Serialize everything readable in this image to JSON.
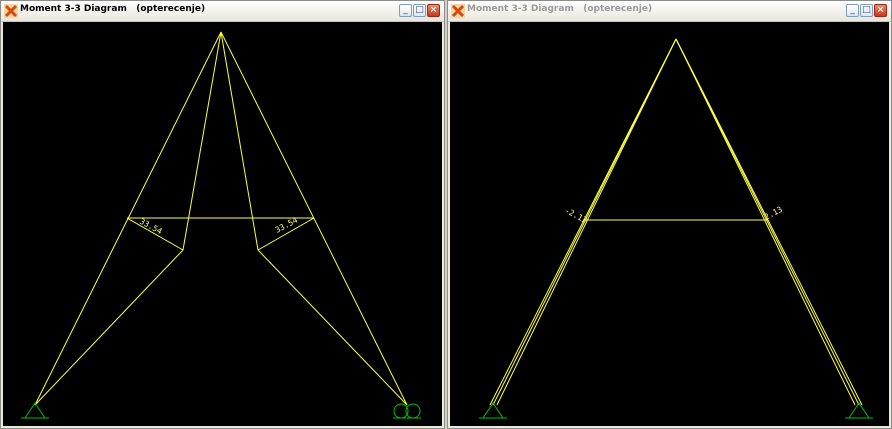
{
  "windows": [
    {
      "title": "Moment 3-3 Diagram   (opterecenje)",
      "active": true,
      "value_labels": [
        "33.54",
        "33.54"
      ]
    },
    {
      "title": "Moment 3-3 Diagram   (opterecenje)",
      "active": false,
      "value_labels": [
        "-2.13",
        "2.13"
      ]
    }
  ],
  "controls": {
    "minimize_icon": "minimize-icon",
    "maximize_icon": "maximize-icon",
    "close_icon": "close-icon"
  },
  "colors": {
    "diagram_line": "#ffff44",
    "support_symbol": "#00c000",
    "canvas_background": "#000000"
  }
}
